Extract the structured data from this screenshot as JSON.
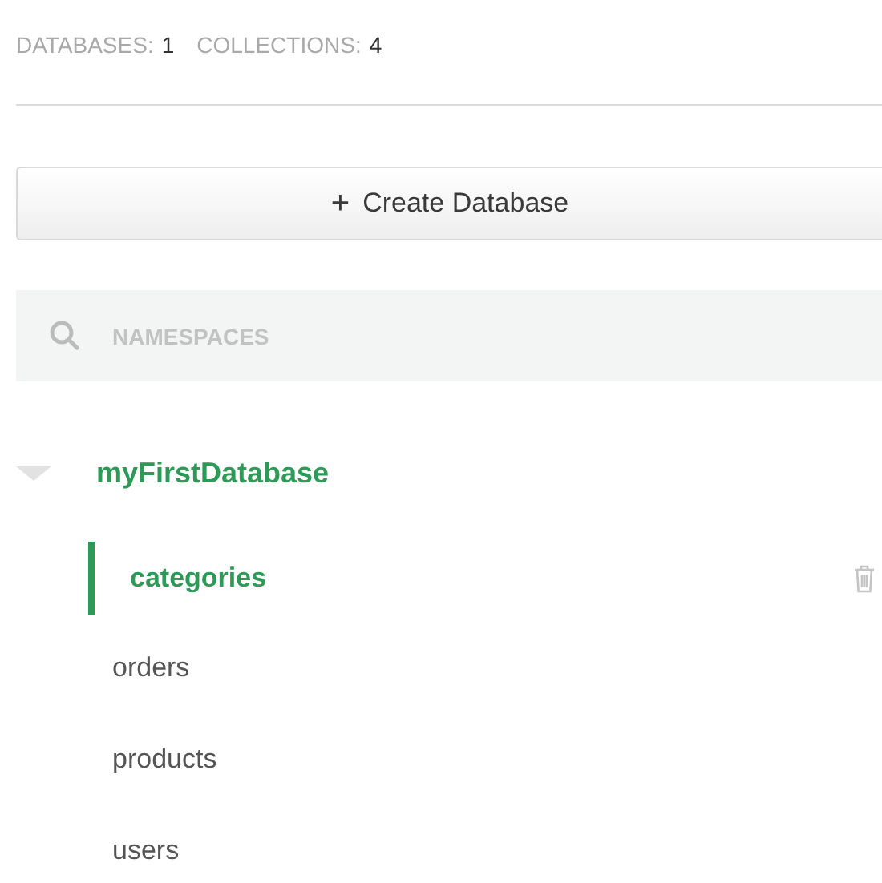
{
  "stats": [
    {
      "label": "DATABASES:",
      "value": "1"
    },
    {
      "label": "COLLECTIONS:",
      "value": "4"
    }
  ],
  "create_button": {
    "icon": "+",
    "label": "Create Database"
  },
  "search": {
    "placeholder": "NAMESPACES"
  },
  "databases": [
    {
      "name": "myFirstDatabase",
      "expanded": true,
      "collections": [
        {
          "name": "categories",
          "selected": true
        },
        {
          "name": "orders",
          "selected": false
        },
        {
          "name": "products",
          "selected": false
        },
        {
          "name": "users",
          "selected": false
        }
      ]
    }
  ]
}
